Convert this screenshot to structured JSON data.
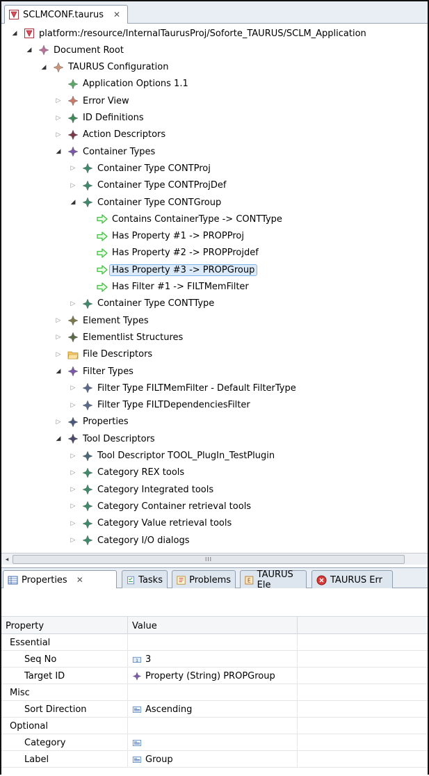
{
  "editor": {
    "tab_title": "SCLMCONF.taurus",
    "tab_close": "✕"
  },
  "tree": [
    {
      "label": "platform:/resource/InternalTaurusProj/Soforte_TAURUS/SCLM_Application",
      "depth": 0,
      "state": "expanded",
      "icon": "model-file-icon"
    },
    {
      "label": "Document Root",
      "depth": 1,
      "state": "expanded",
      "icon": "diamond-icon",
      "color": "#b9719a"
    },
    {
      "label": "TAURUS Configuration",
      "depth": 2,
      "state": "expanded",
      "icon": "diamond-icon",
      "color": "#c9967a"
    },
    {
      "label": "Application Options 1.1",
      "depth": 3,
      "state": "leaf",
      "icon": "diamond-icon",
      "color": "#5aa86a"
    },
    {
      "label": "Error View",
      "depth": 3,
      "state": "collapsed",
      "icon": "diamond-icon",
      "color": "#c97a6a"
    },
    {
      "label": "ID Definitions",
      "depth": 3,
      "state": "collapsed",
      "icon": "diamond-icon",
      "color": "#3f8a5a"
    },
    {
      "label": "Action Descriptors",
      "depth": 3,
      "state": "collapsed",
      "icon": "diamond-icon",
      "color": "#7a3a4a"
    },
    {
      "label": "Container Types",
      "depth": 3,
      "state": "expanded",
      "icon": "diamond-icon",
      "color": "#7a5aa8"
    },
    {
      "label": "Container Type CONTProj",
      "depth": 4,
      "state": "collapsed",
      "icon": "diamond-icon",
      "color": "#3f8a6a"
    },
    {
      "label": "Container Type CONTProjDef",
      "depth": 4,
      "state": "collapsed",
      "icon": "diamond-icon",
      "color": "#3f8a6a"
    },
    {
      "label": "Container Type CONTGroup",
      "depth": 4,
      "state": "expanded",
      "icon": "diamond-icon",
      "color": "#3f8a6a"
    },
    {
      "label": "Contains ContainerType -> CONTType",
      "depth": 5,
      "state": "leaf",
      "icon": "arrow-icon"
    },
    {
      "label": "Has Property #1 -> PROPProj",
      "depth": 5,
      "state": "leaf",
      "icon": "arrow-icon"
    },
    {
      "label": "Has Property #2 -> PROPProjdef",
      "depth": 5,
      "state": "leaf",
      "icon": "arrow-icon"
    },
    {
      "label": "Has Property #3 -> PROPGroup",
      "depth": 5,
      "state": "leaf",
      "icon": "arrow-icon",
      "selected": true
    },
    {
      "label": "Has Filter #1 -> FILTMemFilter",
      "depth": 5,
      "state": "leaf",
      "icon": "arrow-icon"
    },
    {
      "label": "Container Type CONTType",
      "depth": 4,
      "state": "collapsed",
      "icon": "diamond-icon",
      "color": "#3f8a6a"
    },
    {
      "label": "Element Types",
      "depth": 3,
      "state": "collapsed",
      "icon": "diamond-icon",
      "color": "#7a7a4a"
    },
    {
      "label": "Elementlist Structures",
      "depth": 3,
      "state": "collapsed",
      "icon": "diamond-icon",
      "color": "#5a6a4a"
    },
    {
      "label": "File Descriptors",
      "depth": 3,
      "state": "collapsed",
      "icon": "folder-icon"
    },
    {
      "label": "Filter Types",
      "depth": 3,
      "state": "expanded",
      "icon": "diamond-icon",
      "color": "#7a5aa8"
    },
    {
      "label": "Filter Type FILTMemFilter - Default FilterType",
      "depth": 4,
      "state": "collapsed",
      "icon": "diamond-icon",
      "color": "#5a6a8a"
    },
    {
      "label": "Filter Type FILTDependenciesFilter",
      "depth": 4,
      "state": "collapsed",
      "icon": "diamond-icon",
      "color": "#5a6a8a"
    },
    {
      "label": "Properties",
      "depth": 3,
      "state": "collapsed",
      "icon": "diamond-icon",
      "color": "#4a5a7a"
    },
    {
      "label": "Tool Descriptors",
      "depth": 3,
      "state": "expanded",
      "icon": "diamond-icon",
      "color": "#4a4a6a"
    },
    {
      "label": "Tool Descriptor TOOL_PlugIn_TestPlugin",
      "depth": 4,
      "state": "collapsed",
      "icon": "diamond-icon",
      "color": "#4a6a7a"
    },
    {
      "label": "Category REX tools",
      "depth": 4,
      "state": "collapsed",
      "icon": "diamond-icon",
      "color": "#3f8a6a"
    },
    {
      "label": "Category Integrated tools",
      "depth": 4,
      "state": "collapsed",
      "icon": "diamond-icon",
      "color": "#3f8a6a"
    },
    {
      "label": "Category Container retrieval tools",
      "depth": 4,
      "state": "collapsed",
      "icon": "diamond-icon",
      "color": "#3f8a6a"
    },
    {
      "label": "Category Value retrieval tools",
      "depth": 4,
      "state": "collapsed",
      "icon": "diamond-icon",
      "color": "#3f8a6a"
    },
    {
      "label": "Category I/O dialogs",
      "depth": 4,
      "state": "collapsed",
      "icon": "diamond-icon",
      "color": "#3f8a6a"
    }
  ],
  "scrollbar": {
    "left_arrow": "◂",
    "grip": "III"
  },
  "view_tabs": [
    {
      "label": "Properties",
      "icon": "properties-icon",
      "active": true,
      "close": "✕"
    },
    {
      "label": "Tasks",
      "icon": "tasks-icon"
    },
    {
      "label": "Problems",
      "icon": "problems-icon"
    },
    {
      "label": "TAURUS Ele",
      "icon": "taurus-elements-icon"
    },
    {
      "label": "TAURUS Err",
      "icon": "taurus-errors-icon"
    }
  ],
  "properties": {
    "columns": [
      "Property",
      "Value"
    ],
    "rows": [
      {
        "name": "Essential",
        "value": "",
        "level": 0
      },
      {
        "name": "Seq No",
        "value": "3",
        "level": 1,
        "value_icon": "number-icon"
      },
      {
        "name": "Target ID",
        "value": "Property (String) PROPGroup",
        "level": 1,
        "value_icon": "diamond-icon"
      },
      {
        "name": "Misc",
        "value": "",
        "level": 0
      },
      {
        "name": "Sort Direction",
        "value": "Ascending",
        "level": 1,
        "value_icon": "text-icon"
      },
      {
        "name": "Optional",
        "value": "",
        "level": 0
      },
      {
        "name": "Category",
        "value": "",
        "level": 1,
        "value_icon": "text-icon"
      },
      {
        "name": "Label",
        "value": "Group",
        "level": 1,
        "value_icon": "text-icon"
      }
    ]
  },
  "colors": {
    "selection_bg": "#dbeaf9",
    "selection_border": "#7eb4ea",
    "arrow_green": "#3fbf3f",
    "tabbar_bg": "#e9eef5"
  }
}
